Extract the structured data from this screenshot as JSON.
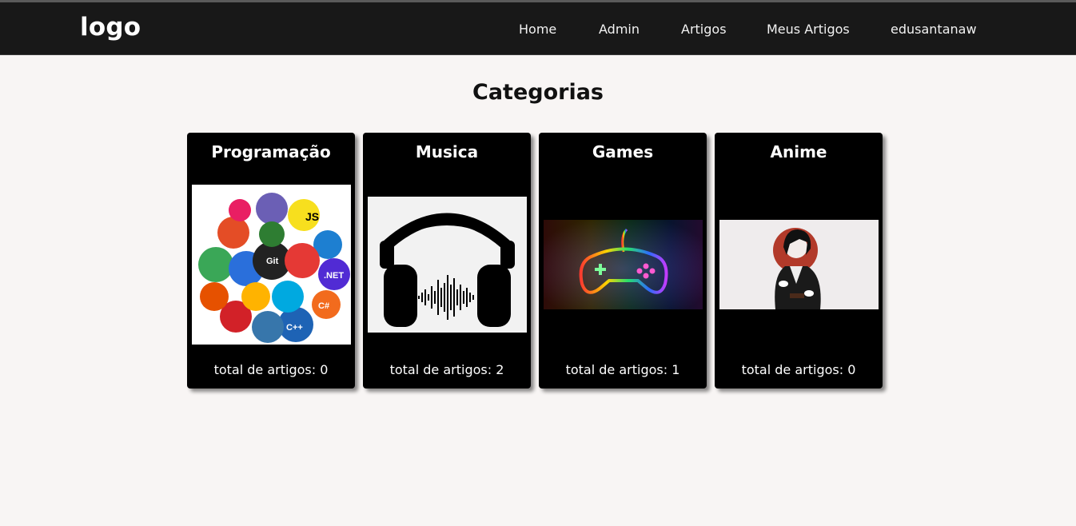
{
  "header": {
    "logo": "logo",
    "nav": [
      "Home",
      "Admin",
      "Artigos",
      "Meus Artigos",
      "edusantanaw"
    ]
  },
  "page": {
    "title": "Categorias"
  },
  "categories": [
    {
      "name": "Programação",
      "count_label": "total de artigos: 0",
      "image_icon": "programming-stickers-icon"
    },
    {
      "name": "Musica",
      "count_label": "total de artigos: 2",
      "image_icon": "headphones-icon"
    },
    {
      "name": "Games",
      "count_label": "total de artigos: 1",
      "image_icon": "gamepad-icon"
    },
    {
      "name": "Anime",
      "count_label": "total de artigos: 0",
      "image_icon": "anime-character-icon"
    }
  ],
  "colors": {
    "navbar": "#181818",
    "background": "#f8f5f4",
    "card": "#000000"
  }
}
